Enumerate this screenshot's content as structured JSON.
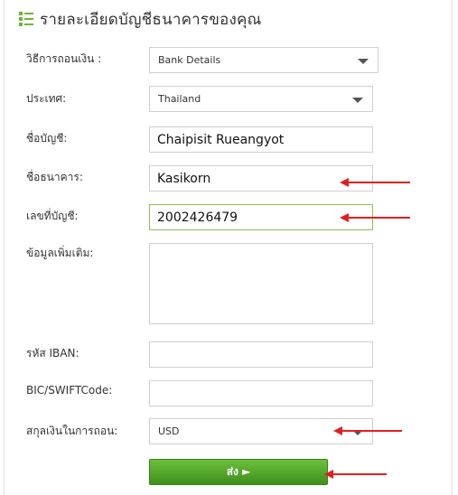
{
  "header": {
    "title": "รายละเอียดบัญชีธนาคารของคุณ",
    "icon": "list-icon",
    "accent_color": "#6bb43a"
  },
  "form": {
    "withdraw_method": {
      "label": "วิธีการถอนเงิน :",
      "value": "Bank Details"
    },
    "country": {
      "label": "ประเทศ:",
      "value": "Thailand"
    },
    "account_name": {
      "label": "ชื่อบัญชี:",
      "value": "Chaipisit Rueangyot"
    },
    "bank_name": {
      "label": "ชื่อธนาคาร:",
      "value": "Kasikorn"
    },
    "account_number": {
      "label": "เลขที่บัญชี:",
      "value": "2002426479"
    },
    "additional_info": {
      "label": "ข้อมูลเพิ่มเติม:",
      "value": ""
    },
    "iban": {
      "label": "รหัส IBAN:",
      "value": ""
    },
    "swift": {
      "label": "BIC/SWIFTCode:",
      "value": ""
    },
    "currency": {
      "label": "สกุลเงินในการถอน:",
      "value": "USD"
    },
    "submit_label": "ส่ง ►"
  },
  "annotations": {
    "arrow_color": "#e02020"
  }
}
